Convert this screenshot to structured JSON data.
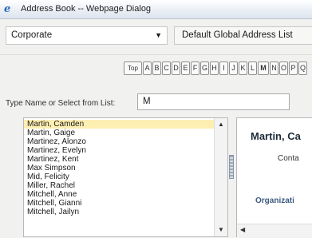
{
  "window": {
    "title": "Address Book -- Webpage Dialog",
    "icon": "ie-icon"
  },
  "address_list": {
    "selected": "Corporate",
    "label": "Default Global Address List"
  },
  "alphabet": {
    "top_label": "Top",
    "letters": [
      "A",
      "B",
      "C",
      "D",
      "E",
      "F",
      "G",
      "H",
      "I",
      "J",
      "K",
      "L",
      "M",
      "N",
      "O",
      "P",
      "Q"
    ],
    "active": "M"
  },
  "search": {
    "label": "Type Name or Select from List:",
    "value": "M"
  },
  "contacts": {
    "items": [
      "Martin, Camden",
      "Martin, Gaige",
      "Martinez, Alonzo",
      "Martinez, Evelyn",
      "Martinez, Kent",
      "Max Simpson",
      "Mid, Felicity",
      "Miller, Rachel",
      "Mitchell, Anne",
      "Mitchell, Gianni",
      "Mitchell, Jailyn"
    ],
    "selected_index": 0
  },
  "detail": {
    "name": "Martin, Ca",
    "contact_label": "Conta",
    "organization_label": "Organizati"
  },
  "colors": {
    "selected_row": "#fdeeb2",
    "title_icon": "#2a67b8"
  }
}
